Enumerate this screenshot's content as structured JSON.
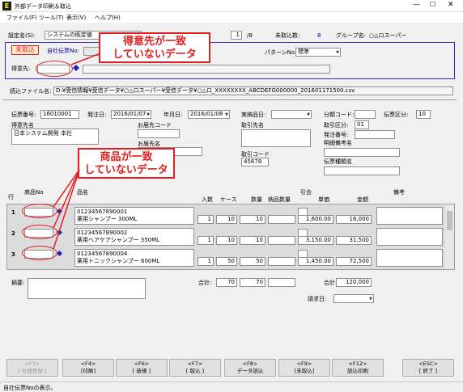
{
  "window": {
    "icon": "app-icon",
    "title": "外部データ印刷＆取込"
  },
  "menu": [
    "ファイル(F)",
    "ツール(T)",
    "表示(V)",
    "ヘルプ(H)"
  ],
  "header": {
    "settings_label": "設定名(S):",
    "settings_value": "システムの既定値",
    "page_value": "1",
    "page_total": "/8",
    "unimported_label": "未取込数:",
    "unimported_count": "8",
    "group_label": "グループ名:",
    "group_value": "○△ロスーパー"
  },
  "status_badge": "未取込",
  "own_slip_label": "自社伝票No:",
  "pattern_label": "パターンNo:",
  "pattern_value": "標準",
  "customer_label": "得意先:",
  "file_label": "読込ファイル名:",
  "file_path": "D:¥受信情報¥受信データ¥○△ロスーパー¥受信データ¥○△ロ_XXXXXXXX_ABCDEFG000000_201601171500.csv",
  "slip": {
    "no_label": "伝票番号:",
    "no_value": "16010001",
    "order_date_label": "発注日:",
    "order_date": "2016/01/07",
    "year_month_label": "年月日:",
    "year_month": "2016/01/08",
    "actual_label": "実納品日:",
    "class_code_label": "分類コード:",
    "slip_type_label": "伝票区分:",
    "slip_type_value": "10",
    "trade_type_label": "取引区分:",
    "trade_type_value": "01",
    "order_no_label": "発注番号:",
    "detail_label": "明細備考名",
    "slip_kind_label": "伝票種類名",
    "customer_name_label": "得意先名",
    "customer_name_value": "日本システム開発 本社",
    "delivery_code_label": "お届先コード",
    "delivery_name_label": "お届先名",
    "partner_label": "取引先名",
    "partner_code_label": "取引コード",
    "partner_code_value": "45678"
  },
  "grid_headers": {
    "row": "行",
    "product_no": "商品No",
    "product_name": "品名",
    "qty_in": "入数",
    "case": "ケース",
    "amount": "数量",
    "delivered": "納品数量",
    "discount": "引合",
    "unit_price": "単価",
    "price": "金額",
    "notes": "備考"
  },
  "rows": [
    {
      "num": "1",
      "code": "01234567890001",
      "name": "薬用シャンプー 300ML",
      "qty_in": "1",
      "case": "10",
      "amount": "10",
      "unit_price": "1,600.00",
      "price": "16,000"
    },
    {
      "num": "2",
      "code": "01234567890002",
      "name": "薬用ヘアケアシャンプー 350ML",
      "qty_in": "1",
      "case": "10",
      "amount": "10",
      "unit_price": "3,150.00",
      "price": "31,500"
    },
    {
      "num": "3",
      "code": "01234567890004",
      "name": "薬用トニックシャンプー 600ML",
      "qty_in": "1",
      "case": "50",
      "amount": "50",
      "unit_price": "1,450.00",
      "price": "72,500"
    }
  ],
  "footer": {
    "memo_label": "摘要:",
    "total_label": "合計:",
    "total_case": "70",
    "total_amount": "70",
    "sum_label": "合計:",
    "sum_value": "120,000",
    "bill_label": "請求日:"
  },
  "callouts": {
    "customer": "得意先が一致\nしていないデータ",
    "product": "商品が一致\nしていないデータ"
  },
  "buttons": [
    {
      "key": "<F3>",
      "label": "[ 仕様登録 ]",
      "disabled": true
    },
    {
      "key": "<F4>",
      "label": "[印刷]"
    },
    {
      "key": "<F6>",
      "label": "[ 新規 ]"
    },
    {
      "key": "<F7>",
      "label": "[ 取込 ]"
    },
    {
      "key": "<F8>",
      "label": "データ読込"
    },
    {
      "key": "<F9>",
      "label": "[未取込]"
    },
    {
      "key": "<F12>",
      "label": "読込印刷"
    },
    {
      "key": "<ESC>",
      "label": "[ 終了 ]"
    }
  ],
  "statusbar": "自社伝票Noの表示。",
  "colors": {
    "accent": "#e02020",
    "badge_bg": "#fff0d0",
    "selected": "#0000a0"
  }
}
